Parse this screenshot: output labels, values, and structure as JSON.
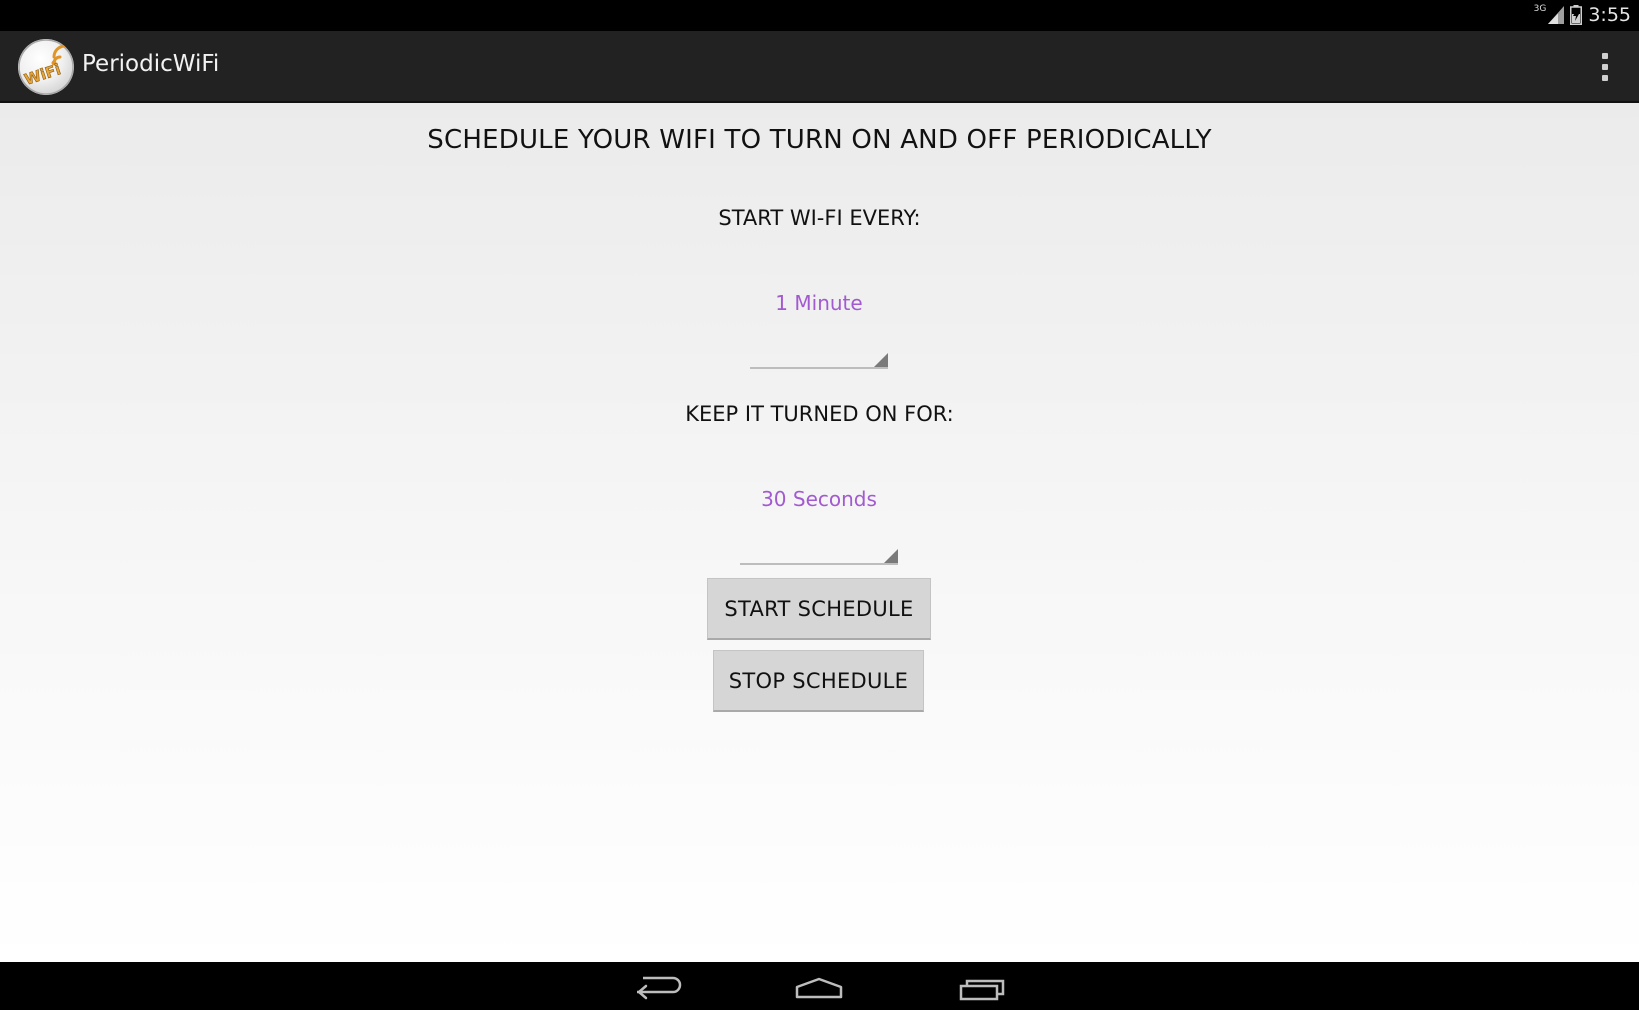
{
  "status_bar": {
    "network_label": "3G",
    "time": "3:55"
  },
  "action_bar": {
    "app_title": "PeriodicWiFi",
    "logo_text": "WiFi",
    "overflow_icon": "more-vert-icon"
  },
  "main": {
    "headline": "SCHEDULE YOUR WIFI TO TURN ON AND OFF PERIODICALLY",
    "start_every_label": "START WI-FI EVERY:",
    "start_every_value": "1 Minute",
    "keep_on_label": "KEEP IT TURNED ON FOR:",
    "keep_on_value": "30 Seconds",
    "start_button": "START SCHEDULE",
    "stop_button": "STOP SCHEDULE"
  },
  "nav_bar": {
    "back_icon": "back-icon",
    "home_icon": "home-icon",
    "recents_icon": "recents-icon"
  },
  "colors": {
    "accent": "#a25ad0",
    "action_bar_bg": "#222222",
    "button_bg": "#d6d6d6"
  }
}
